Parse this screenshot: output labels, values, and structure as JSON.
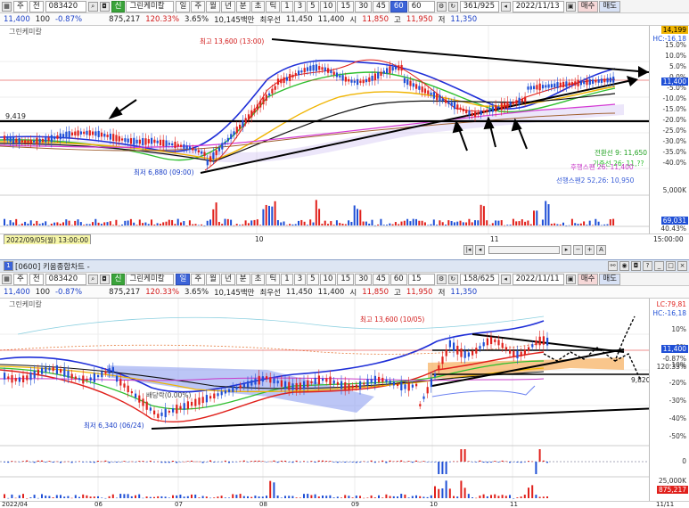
{
  "top": {
    "toolbar1": {
      "icon1": "grid-icon",
      "mode": "주",
      "ex": "전",
      "code": "083420",
      "lock_icon": "lock-icon",
      "type_tag": "신",
      "name": "그린케미칼",
      "periods": [
        "일",
        "주",
        "월",
        "년",
        "분",
        "초",
        "틱"
      ],
      "minutes": [
        "1",
        "3",
        "5",
        "10",
        "15",
        "30",
        "45",
        "60"
      ],
      "selected_minute": "60",
      "minute_field": "60",
      "count": "361/925",
      "date": "2022/11/13",
      "buy": "매수",
      "sell": "매도"
    },
    "toolbar2": {
      "price": "11,400",
      "volratio": "100",
      "chg": "-0.87%",
      "vol": "875,217",
      "volpct": "120.33%",
      "pct2": "3.65%",
      "amount": "10,145백만",
      "bid_label": "최우선",
      "bid1": "11,450",
      "bid2": "11,400",
      "open_label": "시",
      "open": "11,850",
      "high_label": "고",
      "high": "11,950",
      "low_label": "저",
      "low": "11,350"
    },
    "chart_title": "그린케미칼",
    "high_label": "최고 13,600 (13:00)",
    "low_label": "최저 6,880 (09:00)",
    "level_label": "9,419",
    "legend": [
      {
        "text": "전환선 9: 11,650",
        "color": "#1fa01f"
      },
      {
        "text": "기준선 26: 11,??",
        "color": "#2fbf2f"
      },
      {
        "text": "후행스팬 26: 11,400",
        "color": "#c83ac8"
      },
      {
        "text": "선행스팬2 52,26: 10,950",
        "color": "#3a5ed8"
      }
    ],
    "price_axis": [
      "15.0%",
      "10.0%",
      "5.0%",
      "0.0%",
      "-5.0%",
      "-10.0%",
      "-15.0%",
      "-20.0%",
      "-25.0%",
      "-30.0%",
      "-35.0%",
      "-40.0%"
    ],
    "axis_top_tag": "14,199",
    "hc_tag": "HC:-16,18",
    "current_tag": "11,400",
    "vol_axis": "5,000K",
    "vol_tag": "69,031",
    "vol_pct": "40.43%",
    "date_box": "2022/09/05(월) 13:00:00",
    "x_labels": [
      "10",
      "11"
    ],
    "time_label": "15:00:00"
  },
  "window2_title": "[0600] 키움종합차트 -",
  "bottom": {
    "toolbar1": {
      "mode": "주",
      "ex": "전",
      "code": "083420",
      "type_tag": "신",
      "name": "그린케미칼",
      "periods": [
        "일",
        "주",
        "월",
        "년",
        "분",
        "초",
        "틱"
      ],
      "selected_period": "일",
      "minutes": [
        "1",
        "3",
        "5",
        "10",
        "15",
        "30",
        "45",
        "60"
      ],
      "minute_field": "15",
      "count": "158/625",
      "date": "2022/11/11",
      "buy": "매수",
      "sell": "매도"
    },
    "toolbar2": {
      "price": "11,400",
      "volratio": "100",
      "chg": "-0.87%",
      "vol": "875,217",
      "volpct": "120.33%",
      "pct2": "3.65%",
      "amount": "10,145백만",
      "bid_label": "최우선",
      "bid1": "11,450",
      "bid2": "11,400",
      "open_label": "시",
      "open": "11,850",
      "high_label": "고",
      "high": "11,950",
      "low_label": "저",
      "low": "11,350"
    },
    "chart_title": "그린케미칼",
    "high_label": "최고 13,600 (10/05)",
    "low_label": "최저 6,340 (06/24)",
    "mid_label": "배당락(0.00%)",
    "level_label": "9,820",
    "price_axis": [
      "10%",
      "0%",
      "-10%",
      "-20%",
      "-30%",
      "-40%",
      "-50%"
    ],
    "lc_tag": "LC:79,81",
    "hc_tag": "HC:-16,18",
    "current_tag": "11,400",
    "chg_tag": "-0.87%",
    "chg_tag2": "120.33%",
    "osc_axis": "0",
    "vol_axis": "25,000K",
    "vol_tag": "875,217",
    "x_labels": [
      "2022/04",
      "06",
      "07",
      "08",
      "09",
      "10",
      "11",
      "11/11"
    ]
  },
  "colors": {
    "up": "#e0201b",
    "down": "#1f4fd6",
    "accent": "#3b63d8",
    "trend": "#000000"
  }
}
